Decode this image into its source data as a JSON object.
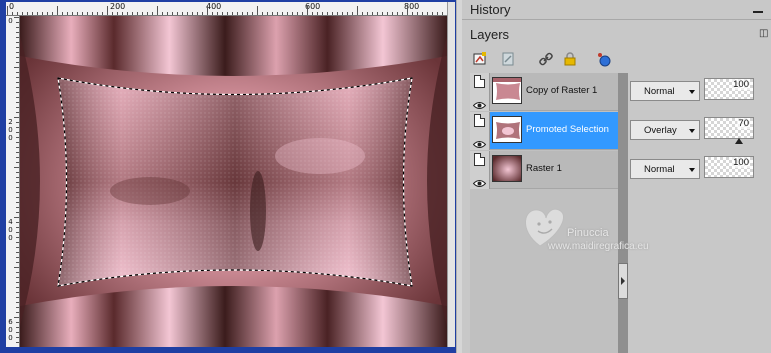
{
  "canvas": {
    "ruler_top_labels": [
      "0",
      "200",
      "400",
      "600",
      "800"
    ],
    "ruler_left_labels": [
      {
        "digits": [
          "0"
        ]
      },
      {
        "digits": [
          "2",
          "0",
          "0"
        ]
      },
      {
        "digits": [
          "4",
          "0",
          "0"
        ]
      },
      {
        "digits": [
          "6",
          "0",
          "0"
        ]
      }
    ],
    "image_colors": {
      "dark": "#3b1c1c",
      "mid": "#a8636b",
      "light": "#f3c6d4",
      "rose": "#c98892"
    }
  },
  "history": {
    "title": "History"
  },
  "layers": {
    "title": "Layers",
    "toolbar": [
      {
        "name": "new-raster-layer-icon"
      },
      {
        "name": "new-vector-layer-icon"
      },
      {
        "name": "link-icon"
      },
      {
        "name": "lock-icon"
      },
      {
        "name": "layer-style-icon"
      }
    ],
    "items": [
      {
        "name": "Copy of Raster 1",
        "blend": "Normal",
        "opacity": "100",
        "selected": false
      },
      {
        "name": "Promoted Selection",
        "blend": "Overlay",
        "opacity": "70",
        "selected": true
      },
      {
        "name": "Raster 1",
        "blend": "Normal",
        "opacity": "100",
        "selected": false
      }
    ]
  },
  "watermark": {
    "name": "Pinuccia",
    "url": "www.maidiregrafica.eu"
  },
  "colors": {
    "selection": "#3399ff",
    "canvas_frame": "#1f3fa3",
    "panel_bg": "#c8c8c8"
  }
}
